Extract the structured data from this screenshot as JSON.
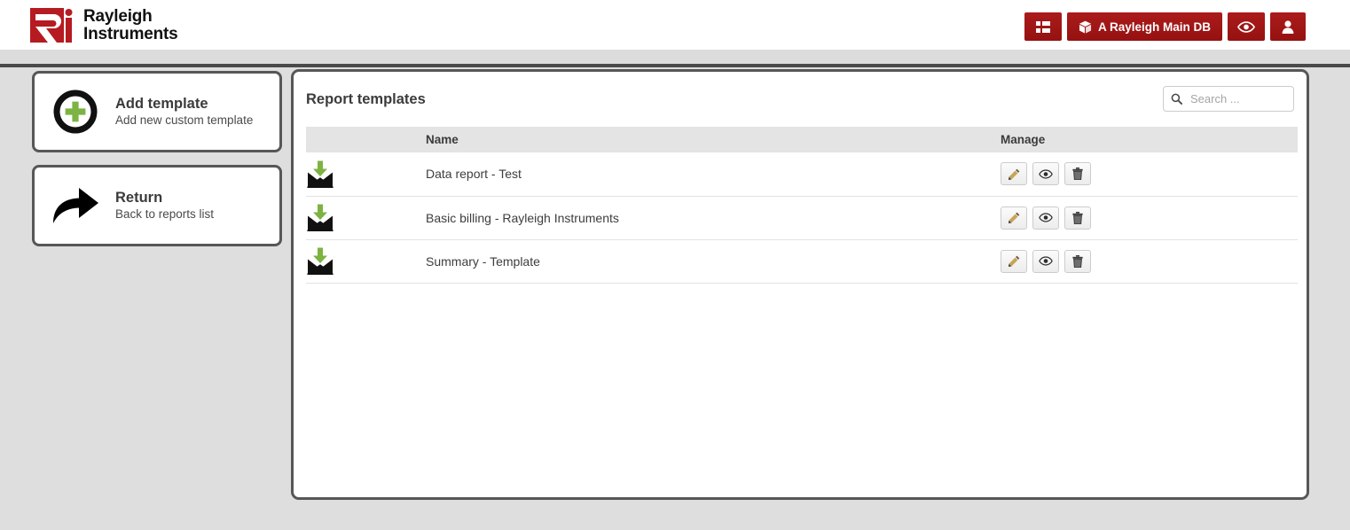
{
  "brand": {
    "name_line1": "Rayleigh",
    "name_line2": "Instruments",
    "logo_color": "#b51b20"
  },
  "header": {
    "accent_color": "#a01414",
    "buttons": [
      {
        "name": "list-button",
        "label": "",
        "icon": "list-icon"
      },
      {
        "name": "database-button",
        "label": "A Rayleigh Main DB",
        "icon": "cube-icon"
      },
      {
        "name": "preview-button",
        "label": "",
        "icon": "eye-icon"
      },
      {
        "name": "account-button",
        "label": "",
        "icon": "user-icon"
      }
    ]
  },
  "sidebar": {
    "cards": [
      {
        "name": "add-template-card",
        "title": "Add template",
        "subtitle": "Add new custom template",
        "icon": "plus-circle-icon",
        "icon_color": "#7cb342"
      },
      {
        "name": "return-card",
        "title": "Return",
        "subtitle": "Back to reports list",
        "icon": "curved-arrow-right-icon",
        "icon_color": "#000000"
      }
    ]
  },
  "main": {
    "title": "Report templates",
    "search": {
      "placeholder": "Search ...",
      "value": "",
      "icon": "search-icon"
    },
    "table": {
      "columns": [
        "",
        "Name",
        "Manage"
      ],
      "rows": [
        {
          "icon": "envelope-upload-icon",
          "name": "Data report - Test"
        },
        {
          "icon": "envelope-upload-icon",
          "name": "Basic billing - Rayleigh Instruments"
        },
        {
          "icon": "envelope-upload-icon",
          "name": "Summary - Template"
        }
      ],
      "actions": [
        {
          "name": "edit-button",
          "icon": "pencil-icon"
        },
        {
          "name": "view-button",
          "icon": "eye-icon"
        },
        {
          "name": "delete-button",
          "icon": "trash-icon"
        }
      ]
    }
  }
}
